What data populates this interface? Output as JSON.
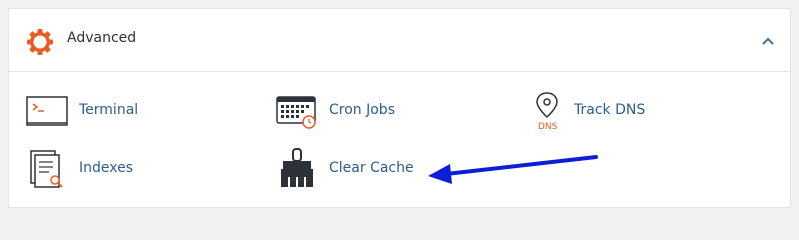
{
  "section": {
    "title": "Advanced",
    "icon": "gear-icon",
    "accent": "#e65d26",
    "collapse_icon": "chevron-up-icon"
  },
  "items": [
    {
      "label": "Terminal",
      "icon": "terminal-icon"
    },
    {
      "label": "Cron Jobs",
      "icon": "cron-jobs-icon"
    },
    {
      "label": "Track DNS",
      "icon": "track-dns-icon",
      "icon_text": "DNS"
    },
    {
      "label": "Indexes",
      "icon": "indexes-icon"
    },
    {
      "label": "Clear Cache",
      "icon": "brush-icon"
    }
  ],
  "annotation": {
    "type": "arrow",
    "color": "#0a1fd6",
    "points_to": "Clear Cache"
  }
}
